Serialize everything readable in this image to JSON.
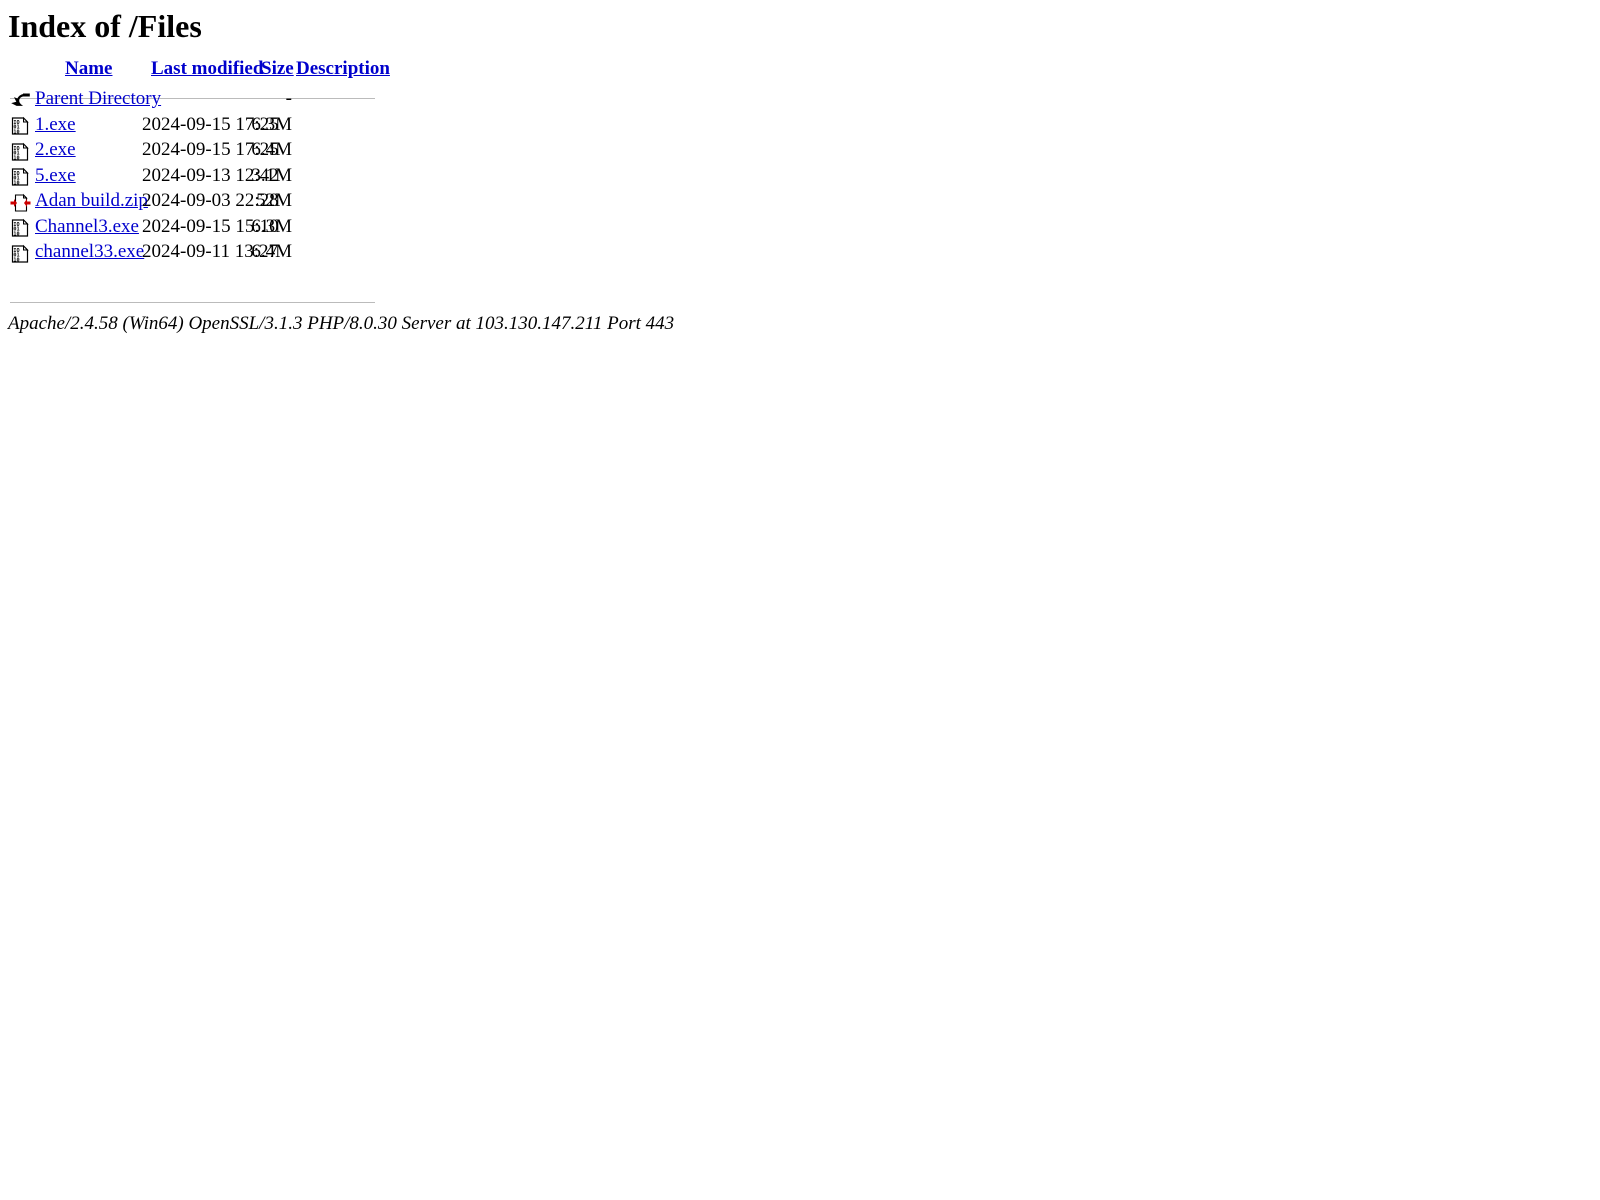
{
  "page": {
    "title": "Index of /Files"
  },
  "table": {
    "headers": {
      "name": "Name",
      "last_modified": "Last modified",
      "size": "Size",
      "description": "Description"
    },
    "rows": [
      {
        "icon": "back-icon",
        "name": "Parent Directory",
        "last_modified": "",
        "size": "-",
        "description": ""
      },
      {
        "icon": "binary-file-icon",
        "name": "1.exe",
        "last_modified": "2024-09-15 17:25",
        "size": "6.3M",
        "description": ""
      },
      {
        "icon": "binary-file-icon",
        "name": "2.exe",
        "last_modified": "2024-09-15 17:25",
        "size": "6.4M",
        "description": ""
      },
      {
        "icon": "binary-file-icon",
        "name": "5.exe",
        "last_modified": "2024-09-13 12:42",
        "size": "3.1M",
        "description": ""
      },
      {
        "icon": "compressed-file-icon",
        "name": "Adan build.zip",
        "last_modified": "2024-09-03 22:28",
        "size": "52M",
        "description": ""
      },
      {
        "icon": "binary-file-icon",
        "name": "Channel3.exe",
        "last_modified": "2024-09-15 15:10",
        "size": "6.3M",
        "description": ""
      },
      {
        "icon": "binary-file-icon",
        "name": "channel33.exe",
        "last_modified": "2024-09-11 13:27",
        "size": "6.4M",
        "description": ""
      }
    ]
  },
  "footer": {
    "signature": "Apache/2.4.58 (Win64) OpenSSL/3.1.3 PHP/8.0.30 Server at 103.130.147.211 Port 443"
  },
  "colors": {
    "link": "#0000cc",
    "text": "#000000",
    "background": "#ffffff",
    "rule": "#bbbbbb",
    "compressed_accent": "#cc0000"
  }
}
